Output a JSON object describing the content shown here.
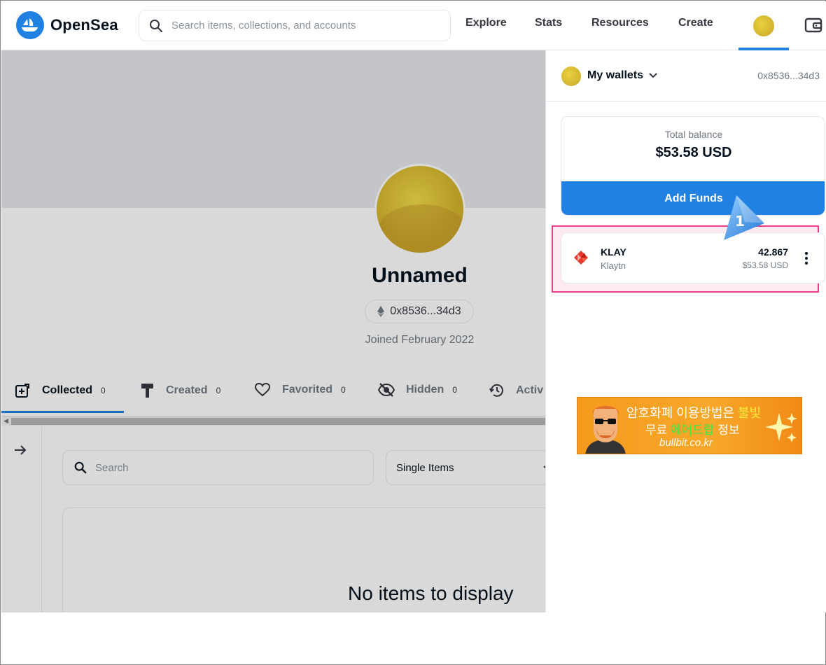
{
  "header": {
    "logo_text": "OpenSea",
    "search_placeholder": "Search items, collections, and accounts",
    "nav": [
      "Explore",
      "Stats",
      "Resources",
      "Create"
    ]
  },
  "profile": {
    "name": "Unnamed",
    "address": "0x8536...34d3",
    "joined": "Joined February 2022",
    "tabs": [
      {
        "label": "Collected",
        "count": "0",
        "icon": "collected-icon"
      },
      {
        "label": "Created",
        "count": "0",
        "icon": "paintbrush-icon"
      },
      {
        "label": "Favorited",
        "count": "0",
        "icon": "heart-icon"
      },
      {
        "label": "Hidden",
        "count": "0",
        "icon": "eye-off-icon"
      },
      {
        "label": "Activ",
        "icon": "history-icon"
      }
    ],
    "search_placeholder": "Search",
    "select_value": "Single Items",
    "empty_message": "No items to display"
  },
  "wallet": {
    "title": "My wallets",
    "address": "0x8536...34d3",
    "balance_label": "Total balance",
    "balance_value": "$53.58 USD",
    "add_funds": "Add Funds",
    "token": {
      "symbol": "KLAY",
      "name": "Klaytn",
      "amount": "42.867",
      "usd": "$53.58 USD"
    },
    "callout": "1"
  },
  "ad": {
    "line1_a": "암호화폐 이용방법은 ",
    "line1_b": "불빛",
    "line2_a": "무료 ",
    "line2_b": "에어드랍",
    "line2_c": " 정보",
    "line3": "bullbit.co.kr"
  },
  "colors": {
    "accent": "#2081e2",
    "highlight": "#e8418a"
  }
}
